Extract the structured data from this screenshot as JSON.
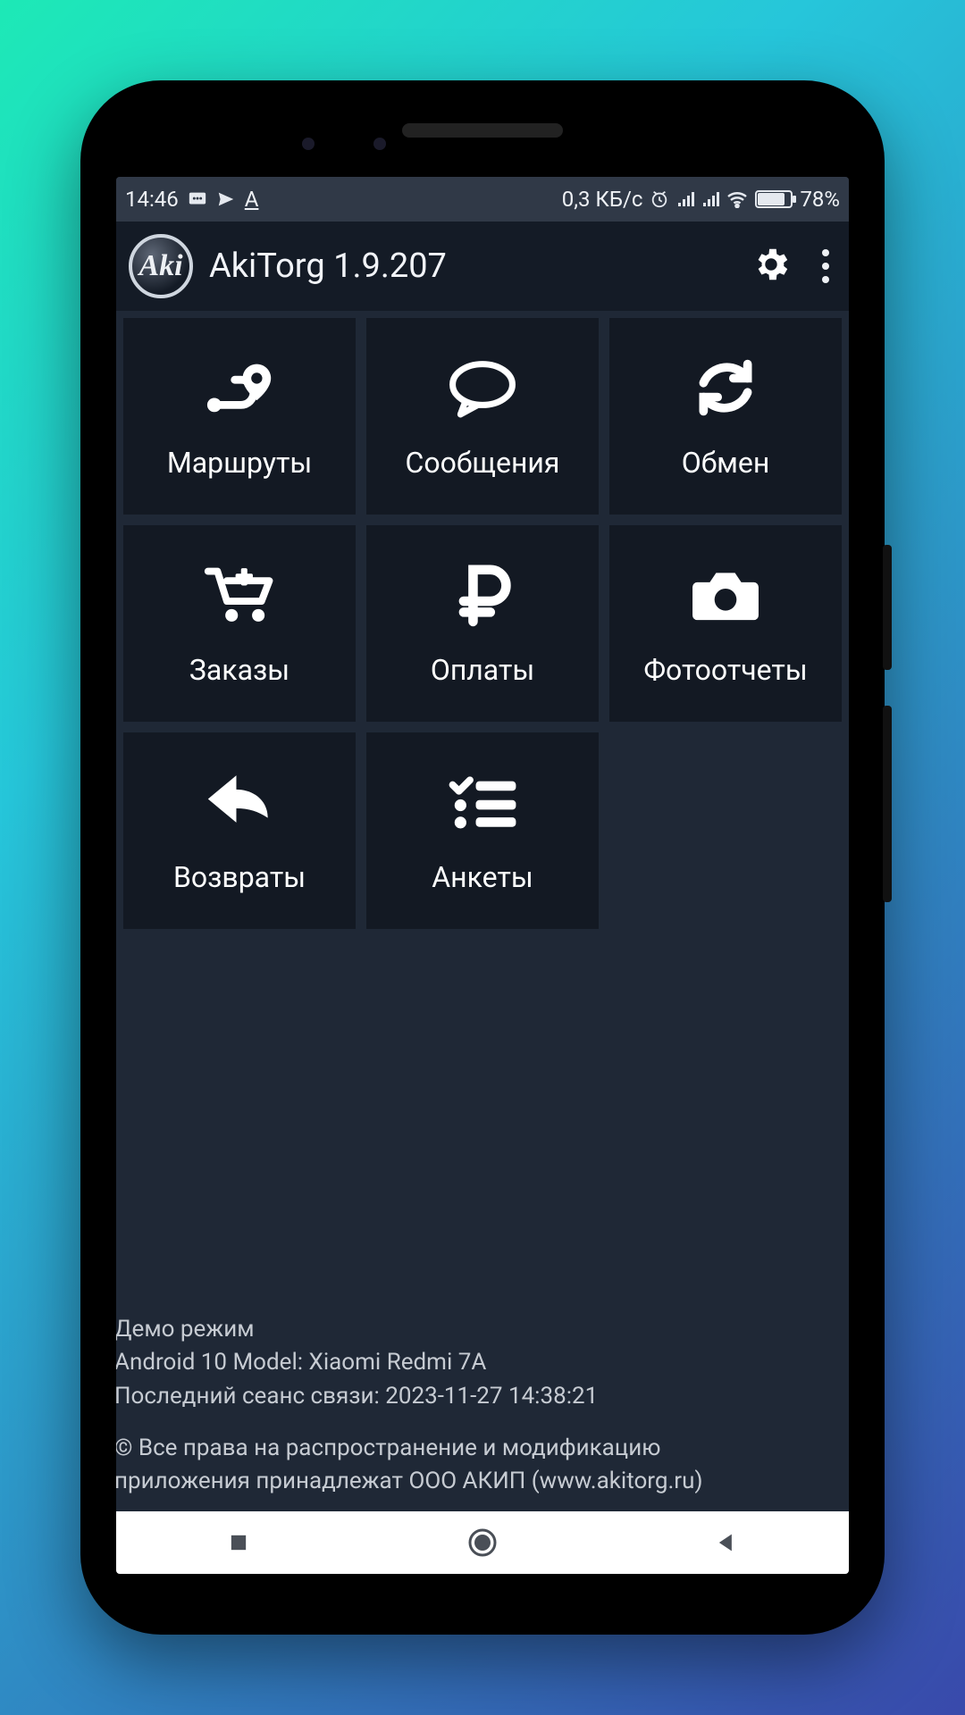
{
  "statusbar": {
    "time": "14:46",
    "net_speed": "0,3 КБ/с",
    "battery_pct": "78%"
  },
  "appbar": {
    "logo_text": "Aki",
    "title": "AkiTorg 1.9.207"
  },
  "tiles": {
    "routes": "Маршруты",
    "messages": "Сообщения",
    "exchange": "Обмен",
    "orders": "Заказы",
    "payments": "Оплаты",
    "photoreports": "Фотоотчеты",
    "returns": "Возвраты",
    "surveys": "Анкеты"
  },
  "footer": {
    "line1": "Демо режим",
    "line2": "Android 10 Model: Xiaomi Redmi 7A",
    "line3": "Последний сеанс связи: 2023-11-27 14:38:21",
    "line4": "© Все права на распространение и модификацию",
    "line5": "приложения принадлежат ООО АКИП (www.akitorg.ru)"
  }
}
